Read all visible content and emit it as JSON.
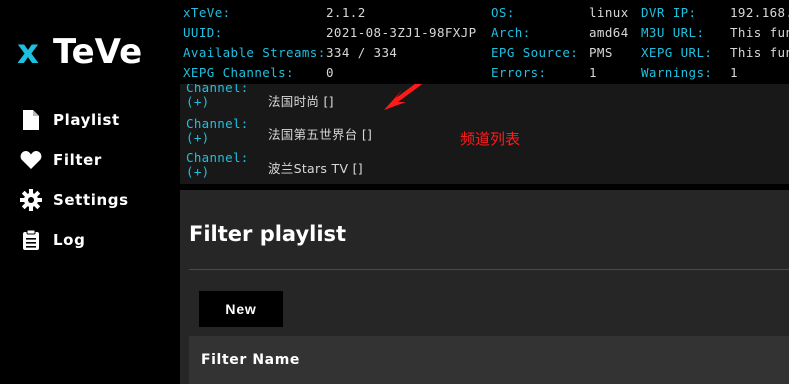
{
  "app": {
    "logo_x": "x",
    "logo_text": "TeVe"
  },
  "sidebar": {
    "items": [
      {
        "label": "Playlist",
        "icon": "file-icon"
      },
      {
        "label": "Filter",
        "icon": "heart-icon"
      },
      {
        "label": "Settings",
        "icon": "gear-icon"
      },
      {
        "label": "Log",
        "icon": "clipboard-icon"
      }
    ]
  },
  "status": {
    "xteve_key": "xTeVe:",
    "xteve_val": "2.1.2",
    "uuid_key": "UUID:",
    "uuid_val": "2021-08-3ZJ1-98FXJP",
    "streams_key": "Available Streams:",
    "streams_val": "334 / 334",
    "xepg_key": "XEPG Channels:",
    "xepg_val": "0",
    "os_key": "OS:",
    "os_val": "linux",
    "arch_key": "Arch:",
    "arch_val": "amd64",
    "epg_key": "EPG Source:",
    "epg_val": "PMS",
    "errors_key": "Errors:",
    "errors_val": "1",
    "dvr_key": "DVR IP:",
    "dvr_val": "192.168.",
    "m3u_key": "M3U URL:",
    "m3u_val": "This fun",
    "xepgurl_key": "XEPG URL:",
    "xepgurl_val": "This fun",
    "warnings_key": "Warnings:",
    "warnings_val": "1"
  },
  "channels": [
    {
      "key_line1": "Channel:",
      "key_line2": "(+)",
      "name": "法国时尚 []"
    },
    {
      "key_line1": "Channel:",
      "key_line2": "(+)",
      "name": "法国第五世界台 []"
    },
    {
      "key_line1": "Channel:",
      "key_line2": "(+)",
      "name": "波兰Stars TV []"
    }
  ],
  "annotation": {
    "label": "频道列表",
    "color": "#ff1a1a"
  },
  "main": {
    "title": "Filter playlist",
    "new_button": "New",
    "table_header_name": "Filter Name"
  },
  "colors": {
    "accent": "#1ec0e0",
    "background": "#000000",
    "panel": "#262626"
  }
}
